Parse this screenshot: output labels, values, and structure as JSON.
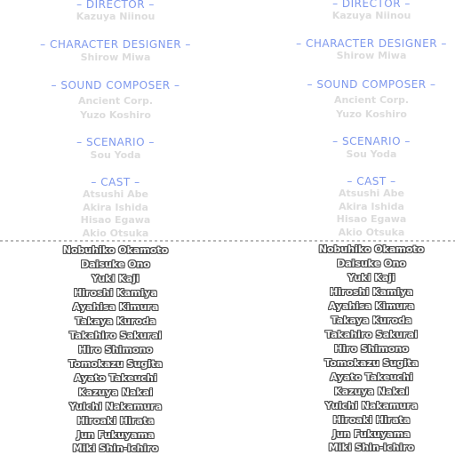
{
  "credits": {
    "director": {
      "heading": "– DIRECTOR –",
      "names": [
        "Kazuya Niinou"
      ]
    },
    "character_designer": {
      "heading": "– CHARACTER DESIGNER –",
      "names": [
        "Shirow Miwa"
      ]
    },
    "sound_composer": {
      "heading": "– SOUND COMPOSER –",
      "names": [
        "Ancient Corp.",
        "Yuzo Koshiro"
      ]
    },
    "scenario": {
      "heading": "– SCENARIO –",
      "names": [
        "Sou Yoda"
      ]
    },
    "cast": {
      "heading": "– CAST –",
      "names_upper": [
        "Atsushi Abe",
        "Akira Ishida",
        "Hisao Egawa",
        "Akio Otsuka"
      ],
      "names_lower": [
        "Nobuhiko Okamoto",
        "Daisuke Ono",
        "Yuki Kaji",
        "Hiroshi Kamiya",
        "Ayahisa Kimura",
        "Takaya Kuroda",
        "Takahiro Sakurai",
        "Hiro Shimono",
        "Tomokazu Sugita",
        "Ayato Takeuchi",
        "Kazuya Nakai",
        "Yuichi Nakamura",
        "Hiroaki Hirata",
        "Jun Fukuyama",
        "Miki Shin-ichiro"
      ]
    }
  },
  "colors": {
    "heading": "#7f99ee",
    "faded_name": "#dcdcdc",
    "outline": "#4a4a4a"
  }
}
